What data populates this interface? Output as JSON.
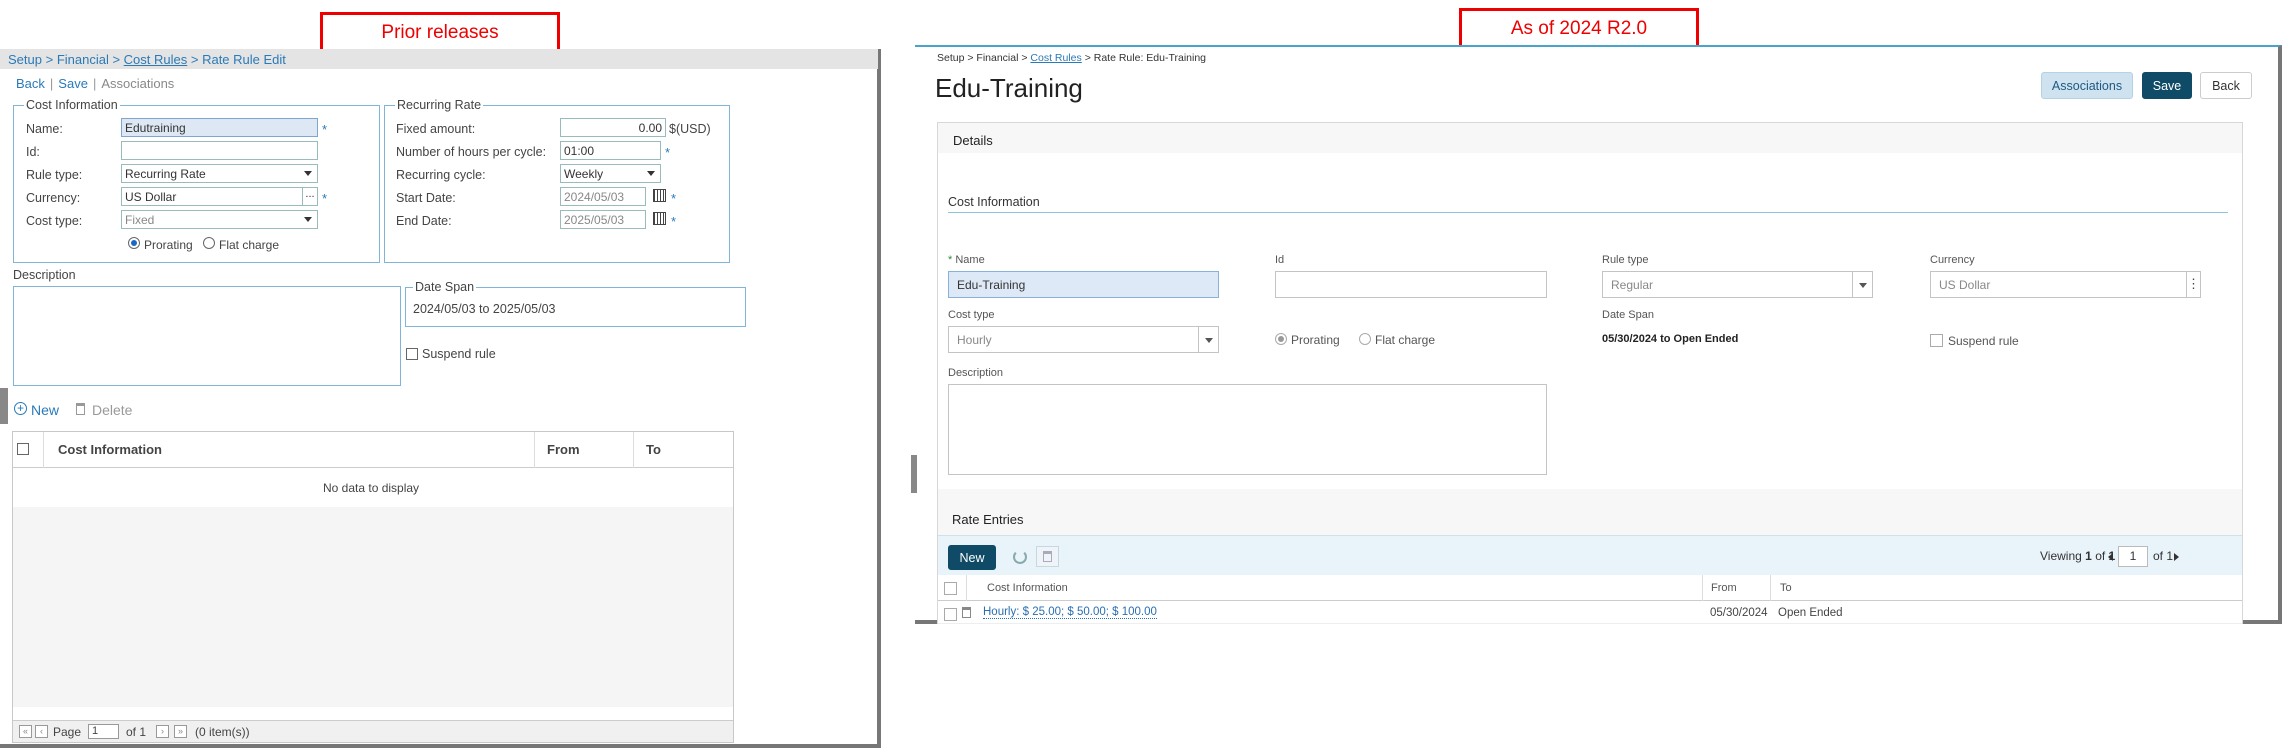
{
  "callouts": {
    "prior": "Prior releases",
    "new": "As of 2024 R2.0"
  },
  "old": {
    "breadcrumb": [
      "Setup",
      "Financial",
      "Cost Rules",
      "Rate Rule Edit"
    ],
    "links": {
      "back": "Back",
      "save": "Save",
      "associations": "Associations"
    },
    "cost_info": {
      "legend": "Cost Information",
      "name_label": "Name:",
      "name_value": "Edutraining",
      "id_label": "Id:",
      "id_value": "",
      "rule_type_label": "Rule type:",
      "rule_type_value": "Recurring Rate",
      "currency_label": "Currency:",
      "currency_value": "US Dollar",
      "currency_btn": "...",
      "cost_type_label": "Cost type:",
      "cost_type_value": "Fixed",
      "prorating": "Prorating",
      "flat_charge": "Flat charge"
    },
    "recurring": {
      "legend": "Recurring Rate",
      "fixed_amount_label": "Fixed amount:",
      "fixed_amount_value": "0.00",
      "fixed_amount_unit": "$(USD)",
      "hours_label": "Number of hours per cycle:",
      "hours_value": "01:00",
      "cycle_label": "Recurring cycle:",
      "cycle_value": "Weekly",
      "start_label": "Start Date:",
      "start_value": "2024/05/03",
      "end_label": "End Date:",
      "end_value": "2025/05/03"
    },
    "description_label": "Description",
    "date_span": {
      "legend": "Date Span",
      "value": "2024/05/03 to 2025/05/03"
    },
    "suspend_label": "Suspend rule",
    "actions": {
      "new": "New",
      "delete": "Delete"
    },
    "grid": {
      "columns": [
        "Cost Information",
        "From",
        "To"
      ],
      "empty": "No data to display",
      "page_label": "Page",
      "page_value": "1",
      "of_label": "of 1",
      "items": "(0 item(s))"
    }
  },
  "new": {
    "breadcrumb": {
      "setup": "Setup",
      "financial": "Financial",
      "cost_rules": "Cost Rules",
      "current": "Rate Rule: Edu-Training"
    },
    "title": "Edu-Training",
    "buttons": {
      "associations": "Associations",
      "save": "Save",
      "back": "Back"
    },
    "details_header": "Details",
    "cost_info_header": "Cost Information",
    "fields": {
      "name_label": "Name",
      "name_value": "Edu-Training",
      "id_label": "Id",
      "id_value": "",
      "rule_type_label": "Rule type",
      "rule_type_value": "Regular",
      "currency_label": "Currency",
      "currency_value": "US Dollar",
      "cost_type_label": "Cost type",
      "cost_type_value": "Hourly",
      "prorating": "Prorating",
      "flat_charge": "Flat charge",
      "date_span_label": "Date Span",
      "date_span_value": "05/30/2024 to Open Ended",
      "suspend_label": "Suspend rule",
      "description_label": "Description"
    },
    "rate_entries": {
      "header": "Rate Entries",
      "new_button": "New",
      "viewing_prefix": "Viewing",
      "viewing_value": "1",
      "viewing_of": "of",
      "viewing_total": "1",
      "page_value": "1",
      "page_of": "of 1",
      "columns": [
        "Cost Information",
        "From",
        "To"
      ],
      "rows": [
        {
          "cost_info": "Hourly: $ 25.00; $ 50.00; $ 100.00",
          "from": "05/30/2024",
          "to": "Open Ended"
        }
      ]
    }
  }
}
